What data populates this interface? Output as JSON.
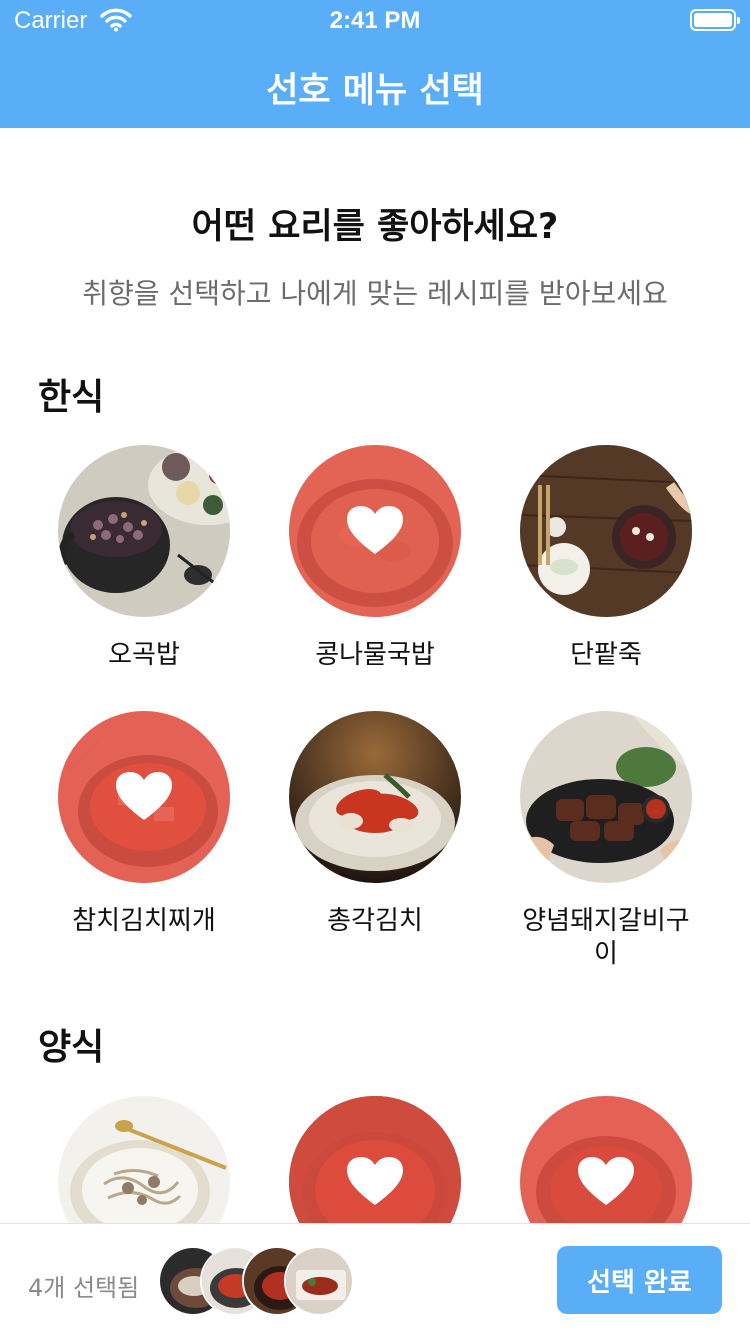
{
  "status_bar": {
    "carrier": "Carrier",
    "time": "2:41 PM"
  },
  "nav": {
    "title": "선호 메뉴 선택"
  },
  "intro": {
    "title": "어떤 요리를 좋아하세요?",
    "subtitle": "취향을 선택하고 나에게 맞는 레시피를 받아보세요"
  },
  "sections": [
    {
      "title": "한식",
      "items": [
        {
          "name": "오곡밥",
          "selected": false
        },
        {
          "name": "콩나물국밥",
          "selected": true
        },
        {
          "name": "단팥죽",
          "selected": false
        },
        {
          "name": "참치김치찌개",
          "selected": true
        },
        {
          "name": "총각김치",
          "selected": false
        },
        {
          "name": "양념돼지갈비구이",
          "selected": false
        }
      ]
    },
    {
      "title": "양식",
      "items": [
        {
          "selected": false
        },
        {
          "selected": true
        },
        {
          "selected": true
        }
      ]
    }
  ],
  "bottom": {
    "selected_count_label": "4개 선택됨",
    "done_label": "선택 완료"
  },
  "colors": {
    "primary": "#5aaef7",
    "selected_overlay": "#e45042"
  }
}
